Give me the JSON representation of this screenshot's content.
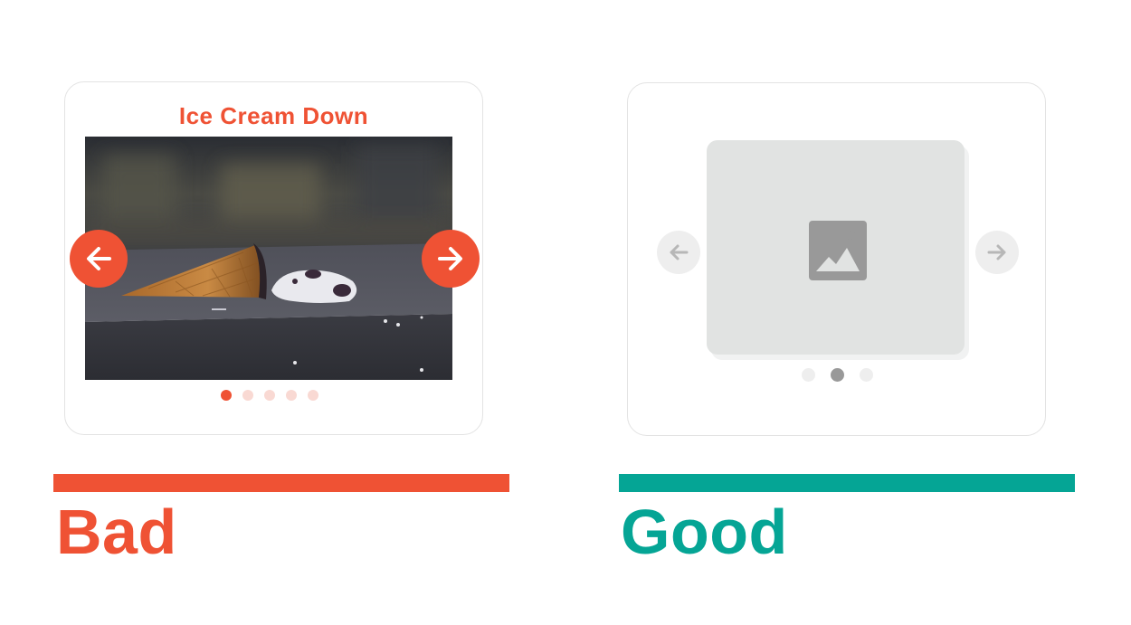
{
  "colors": {
    "bad_accent": "#ef5234",
    "bad_dot_inactive": "#f9d9d3",
    "good_accent": "#05a595",
    "placeholder_bg": "#e1e3e2",
    "placeholder_icon": "#999999",
    "ghost_button_bg": "#eeeeee",
    "ghost_arrow": "#b7b7b7",
    "good_dot_active": "#999999",
    "good_dot_inactive": "#eeeeee"
  },
  "bad_example": {
    "title": "Ice Cream Down",
    "image_icon": "fallen-ice-cream-photo",
    "prev_icon": "arrow-left-icon",
    "next_icon": "arrow-right-icon",
    "dots_total": 5,
    "active_dot": 1,
    "label": "Bad"
  },
  "good_example": {
    "image_icon": "image-placeholder-icon",
    "prev_icon": "arrow-left-icon",
    "next_icon": "arrow-right-icon",
    "dots_total": 3,
    "active_dot": 2,
    "label": "Good"
  }
}
